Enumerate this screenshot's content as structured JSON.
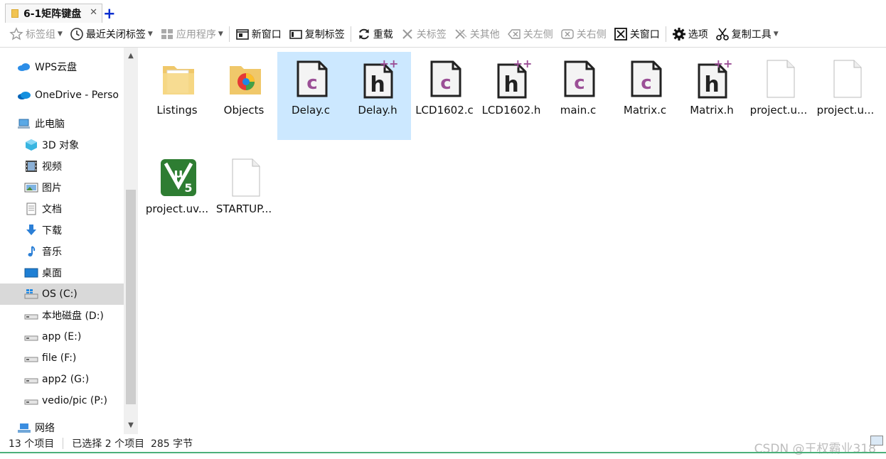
{
  "tab": {
    "title": "6-1矩阵键盘",
    "close": "✕",
    "add": "+"
  },
  "toolbar": {
    "bookmarks": "标签组",
    "recent_closed": "最近关闭标签",
    "apps": "应用程序",
    "new_window": "新窗口",
    "copy_tab": "复制标签",
    "reload": "重载",
    "close_tab": "关标签",
    "close_others": "关其他",
    "close_left": "关左侧",
    "close_right": "关右侧",
    "close_window": "关窗口",
    "options": "选项",
    "copy_tools": "复制工具"
  },
  "nav": {
    "items": [
      {
        "label": "WPS云盘",
        "icon": "cloud-icon"
      },
      {
        "label": "OneDrive - Perso",
        "icon": "onedrive-icon"
      },
      {
        "label": "此电脑",
        "icon": "computer-icon"
      },
      {
        "label": "3D 对象",
        "icon": "3d-objects-icon"
      },
      {
        "label": "视频",
        "icon": "video-icon"
      },
      {
        "label": "图片",
        "icon": "pictures-icon"
      },
      {
        "label": "文档",
        "icon": "documents-icon"
      },
      {
        "label": "下载",
        "icon": "download-icon"
      },
      {
        "label": "音乐",
        "icon": "music-icon"
      },
      {
        "label": "桌面",
        "icon": "desktop-icon"
      },
      {
        "label": "OS (C:)",
        "icon": "system-drive-icon",
        "selected": true
      },
      {
        "label": "本地磁盘 (D:)",
        "icon": "drive-icon"
      },
      {
        "label": "app (E:)",
        "icon": "drive-icon"
      },
      {
        "label": "file (F:)",
        "icon": "drive-icon"
      },
      {
        "label": "app2 (G:)",
        "icon": "drive-icon"
      },
      {
        "label": "vedio/pic (P:)",
        "icon": "drive-icon"
      },
      {
        "label": "网络",
        "icon": "network-icon"
      }
    ]
  },
  "files": [
    {
      "name": "Listings",
      "type": "folder",
      "selected": false
    },
    {
      "name": "Objects",
      "type": "folder-app",
      "selected": false
    },
    {
      "name": "Delay.c",
      "type": "c",
      "selected": true
    },
    {
      "name": "Delay.h",
      "type": "h",
      "selected": true
    },
    {
      "name": "LCD1602.c",
      "type": "c",
      "selected": false
    },
    {
      "name": "LCD1602.h",
      "type": "h",
      "selected": false
    },
    {
      "name": "main.c",
      "type": "c",
      "selected": false
    },
    {
      "name": "Matrix.c",
      "type": "c",
      "selected": false
    },
    {
      "name": "Matrix.h",
      "type": "h",
      "selected": false
    },
    {
      "name": "project.u...",
      "type": "blank",
      "selected": false
    },
    {
      "name": "project.u...",
      "type": "blank",
      "selected": false
    },
    {
      "name": "project.uv...",
      "type": "keil",
      "selected": false
    },
    {
      "name": "STARTUP...",
      "type": "blank",
      "selected": false
    }
  ],
  "icon_letters": {
    "c": "c",
    "h": "h",
    "plus": "++",
    "mu": "μ",
    "five": "5"
  },
  "status": {
    "count": "13 个项目",
    "selection": "已选择 2 个项目  285 字节",
    "watermark": "CSDN @王权霸业318"
  },
  "colors": {
    "selection": "#cce8ff",
    "c_letter": "#9b4f96",
    "keil_green": "#2e7d32",
    "tab_add": "#0a2fd0"
  }
}
